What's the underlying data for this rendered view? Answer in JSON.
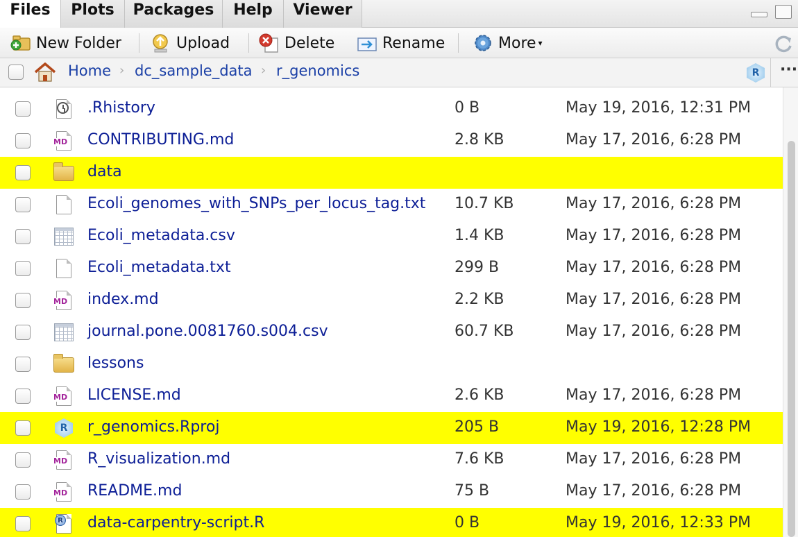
{
  "tabs": [
    "Files",
    "Plots",
    "Packages",
    "Help",
    "Viewer"
  ],
  "active_tab": "Files",
  "toolbar": {
    "new_folder": "New Folder",
    "upload": "Upload",
    "delete": "Delete",
    "rename": "Rename",
    "more": "More"
  },
  "breadcrumb": [
    "Home",
    "dc_sample_data",
    "r_genomics"
  ],
  "files": [
    {
      "name": ".Rhistory",
      "size": "0 B",
      "modified": "May 19, 2016, 12:31 PM",
      "icon": "history-icon",
      "highlighted": false
    },
    {
      "name": "CONTRIBUTING.md",
      "size": "2.8 KB",
      "modified": "May 17, 2016, 6:28 PM",
      "icon": "markdown-file-icon",
      "highlighted": false
    },
    {
      "name": "data",
      "size": "",
      "modified": "",
      "icon": "folder-icon",
      "highlighted": true
    },
    {
      "name": "Ecoli_genomes_with_SNPs_per_locus_tag.txt",
      "size": "10.7 KB",
      "modified": "May 17, 2016, 6:28 PM",
      "icon": "text-file-icon",
      "highlighted": false
    },
    {
      "name": "Ecoli_metadata.csv",
      "size": "1.4 KB",
      "modified": "May 17, 2016, 6:28 PM",
      "icon": "csv-file-icon",
      "highlighted": false
    },
    {
      "name": "Ecoli_metadata.txt",
      "size": "299 B",
      "modified": "May 17, 2016, 6:28 PM",
      "icon": "text-file-icon",
      "highlighted": false
    },
    {
      "name": "index.md",
      "size": "2.2 KB",
      "modified": "May 17, 2016, 6:28 PM",
      "icon": "markdown-file-icon",
      "highlighted": false
    },
    {
      "name": "journal.pone.0081760.s004.csv",
      "size": "60.7 KB",
      "modified": "May 17, 2016, 6:28 PM",
      "icon": "csv-file-icon",
      "highlighted": false
    },
    {
      "name": "lessons",
      "size": "",
      "modified": "",
      "icon": "folder-icon",
      "highlighted": false
    },
    {
      "name": "LICENSE.md",
      "size": "2.6 KB",
      "modified": "May 17, 2016, 6:28 PM",
      "icon": "markdown-file-icon",
      "highlighted": false
    },
    {
      "name": "r_genomics.Rproj",
      "size": "205 B",
      "modified": "May 19, 2016, 12:28 PM",
      "icon": "rproject-icon",
      "highlighted": true
    },
    {
      "name": "R_visualization.md",
      "size": "7.6 KB",
      "modified": "May 17, 2016, 6:28 PM",
      "icon": "markdown-file-icon",
      "highlighted": false
    },
    {
      "name": "README.md",
      "size": "75 B",
      "modified": "May 17, 2016, 6:28 PM",
      "icon": "markdown-file-icon",
      "highlighted": false
    },
    {
      "name": "data-carpentry-script.R",
      "size": "0 B",
      "modified": "May 19, 2016, 12:33 PM",
      "icon": "r-script-icon",
      "highlighted": true
    }
  ],
  "colors": {
    "highlight": "#ffff00",
    "link": "#0c1e96"
  }
}
